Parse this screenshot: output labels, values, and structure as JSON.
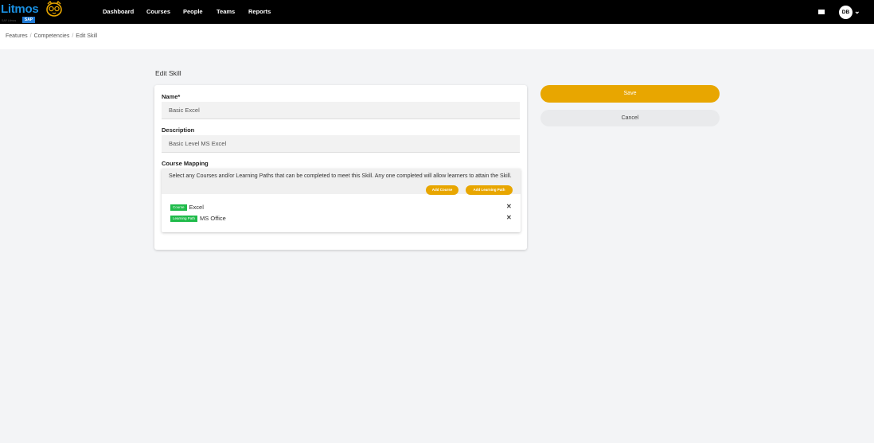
{
  "brand": {
    "name": "Litmos",
    "badge": "SAP",
    "subtitle": "SAP Litmos",
    "accent": "#1a8fe0"
  },
  "nav": {
    "items": [
      {
        "label": "Dashboard"
      },
      {
        "label": "Courses"
      },
      {
        "label": "People"
      },
      {
        "label": "Teams"
      },
      {
        "label": "Reports"
      }
    ]
  },
  "header": {
    "mail_icon": "envelope-icon",
    "avatar_initials": "DB",
    "menu_icon": "chevron-down-icon"
  },
  "breadcrumb": [
    "Features",
    "Competencies",
    "Edit Skill"
  ],
  "page": {
    "title": "Edit Skill"
  },
  "form": {
    "name_label": "Name*",
    "name_value": "Basic Excel",
    "description_label": "Description",
    "description_value": "Basic Level MS Excel",
    "mapping_label": "Course Mapping",
    "mapping_help": "Select any Courses and/or Learning Paths that can be completed to meet this Skill. Any one completed will allow learners to attain the Skill.",
    "add_course_label": "Add Course",
    "add_path_label": "Add Learning Path",
    "mappings": [
      {
        "tag": "Course",
        "name": "Excel",
        "remove_icon": "close-icon"
      },
      {
        "tag": "Learning Path",
        "name": "MS Office",
        "remove_icon": "close-icon"
      }
    ]
  },
  "actions": {
    "save_label": "Save",
    "cancel_label": "Cancel"
  },
  "colors": {
    "primary": "#e8a600",
    "tag": "#1fbb4a",
    "topbar": "#000000",
    "background": "#f3f4f6"
  }
}
